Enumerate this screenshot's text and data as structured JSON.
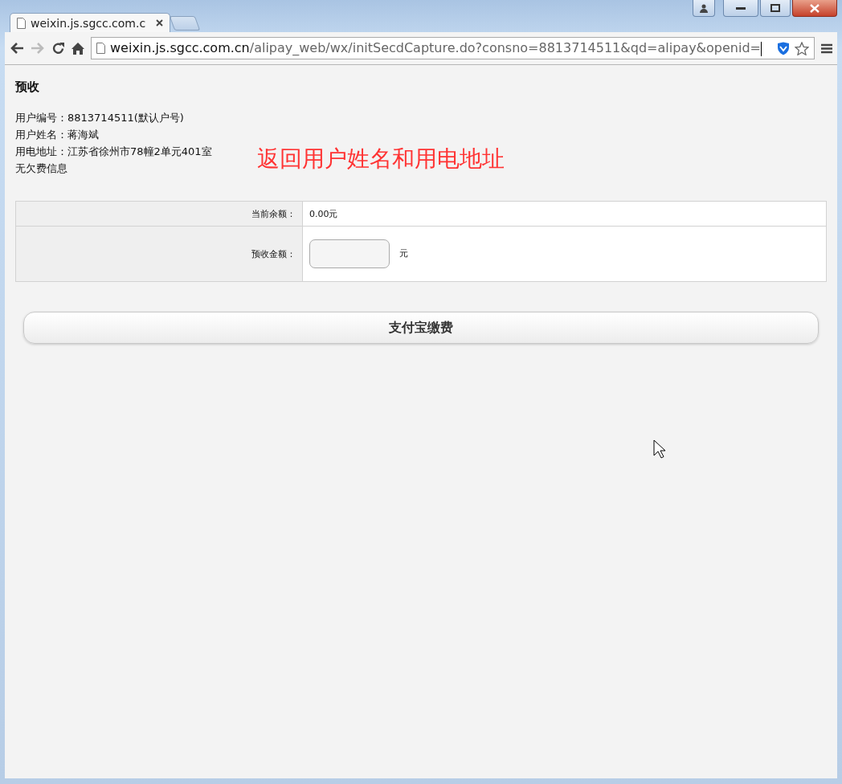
{
  "browser": {
    "tab": {
      "title": "weixin.js.sgcc.com.c"
    },
    "address": {
      "host": "weixin.js.sgcc.com.cn",
      "path": "/alipay_web/wx/initSecdCapture.do?consno=8813714511&qd=alipay&openid="
    }
  },
  "page": {
    "heading": "预收",
    "info": [
      "用户编号：8813714511(默认户号)",
      "用户姓名：蒋海斌",
      "用电地址：江苏省徐州市78幢2单元401室",
      "无欠费信息"
    ],
    "annotation": "返回用户姓名和用电地址",
    "table": {
      "rows": [
        {
          "kind": "text",
          "label": "当前余额：",
          "value": "0.00元"
        },
        {
          "kind": "input",
          "label": "预收金额：",
          "unit": "元"
        }
      ]
    },
    "button": "支付宝缴费"
  }
}
